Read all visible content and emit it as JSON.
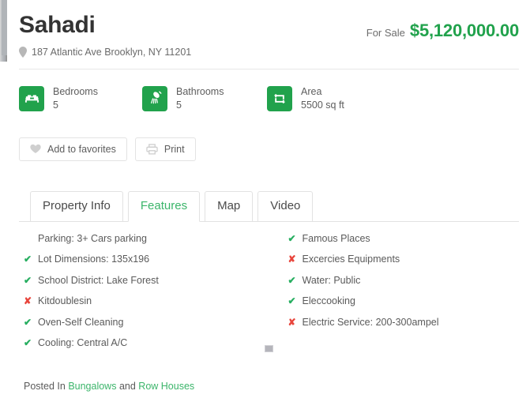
{
  "listing": {
    "title": "Sahadi",
    "status_label": "For Sale",
    "price": "$5,120,000.00",
    "address": "187 Atlantic Ave Brooklyn, NY 11201",
    "pin_icon": "map-pin-icon"
  },
  "facts": [
    {
      "icon": "bed-icon",
      "label": "Bedrooms",
      "value": "5"
    },
    {
      "icon": "shower-icon",
      "label": "Bathrooms",
      "value": "5"
    },
    {
      "icon": "area-arrows-icon",
      "label": "Area",
      "value": "5500 sq ft"
    }
  ],
  "actions": [
    {
      "icon": "heart-icon",
      "label": "Add to favorites"
    },
    {
      "icon": "printer-icon",
      "label": "Print"
    }
  ],
  "tabs": [
    {
      "label": "Property Info",
      "active": false
    },
    {
      "label": "Features",
      "active": true
    },
    {
      "label": "Map",
      "active": false
    },
    {
      "label": "Video",
      "active": false
    }
  ],
  "features": {
    "left": [
      {
        "mark": "none",
        "text": "Parking: 3+ Cars parking"
      },
      {
        "mark": "yes",
        "text": "Lot Dimensions: 135x196"
      },
      {
        "mark": "yes",
        "text": "School District: Lake Forest"
      },
      {
        "mark": "no",
        "text": "Kitdoublesin"
      },
      {
        "mark": "yes",
        "text": "Oven-Self Cleaning"
      },
      {
        "mark": "yes",
        "text": "Cooling: Central A/C"
      }
    ],
    "right": [
      {
        "mark": "yes",
        "text": "Famous Places"
      },
      {
        "mark": "no",
        "text": "Excercies Equipments"
      },
      {
        "mark": "yes",
        "text": "Water: Public"
      },
      {
        "mark": "yes",
        "text": "Eleccooking"
      },
      {
        "mark": "no",
        "text": "Electric Service: 200-300ampel"
      }
    ]
  },
  "footer": {
    "posted_prefix": "Posted In",
    "category_one": "Bungalows",
    "conjunction": "and",
    "category_two": "Row Houses"
  },
  "colors": {
    "brand_green": "#21a24c",
    "link_green": "#3bb56a",
    "check_green": "#27ae60",
    "cross_red": "#e8453c"
  },
  "marks": {
    "yes": "✔",
    "no": "✘",
    "none": ""
  }
}
